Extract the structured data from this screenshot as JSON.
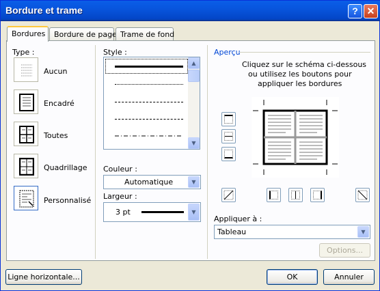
{
  "window": {
    "title": "Bordure et trame"
  },
  "titlebar_buttons": {
    "help": "?",
    "close": "✕"
  },
  "tabs": [
    {
      "label": "Bordures"
    },
    {
      "label": "Bordure de page"
    },
    {
      "label": "Trame de fond"
    }
  ],
  "setting": {
    "label": "Type :",
    "items": [
      {
        "label": "Aucun"
      },
      {
        "label": "Encadré"
      },
      {
        "label": "Toutes"
      },
      {
        "label": "Quadrillage"
      },
      {
        "label": "Personnalisé",
        "selected": true
      }
    ]
  },
  "style": {
    "label": "Style :",
    "selected_index": 0,
    "line_styles": [
      "solid",
      "dotted",
      "dashed-fine",
      "dashed",
      "dash-dot"
    ]
  },
  "color": {
    "label": "Couleur :",
    "value": "Automatique"
  },
  "width": {
    "label": "Largeur :",
    "value": "3 pt"
  },
  "preview": {
    "label": "Aperçu",
    "instructions_1": "Cliquez sur le schéma ci-dessous",
    "instructions_2": "ou utilisez les boutons pour",
    "instructions_3": "appliquer les bordures"
  },
  "apply_to": {
    "label": "Appliquer à :",
    "value": "Tableau"
  },
  "buttons": {
    "options": "Options...",
    "horizontal_line": "Ligne horizontale...",
    "ok": "OK",
    "cancel": "Annuler"
  },
  "colors": {
    "accent": "#0a5ee8",
    "tab_highlight": "#ffc83c",
    "dialog_bg": "#ece9d8"
  }
}
